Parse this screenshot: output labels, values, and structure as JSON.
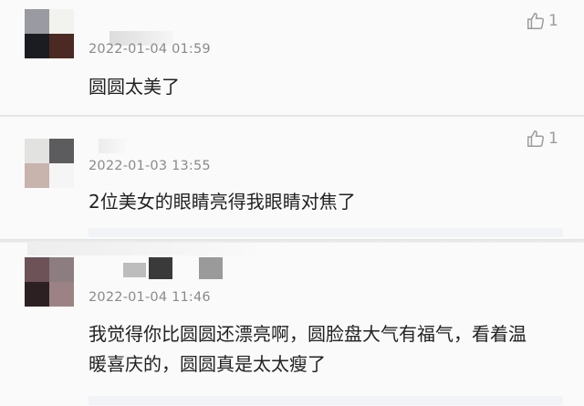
{
  "comments": [
    {
      "timestamp": "2022-01-04 01:59",
      "text": "圆圆太美了",
      "likes": "1"
    },
    {
      "timestamp": "2022-01-03 13:55",
      "text": "2位美女的眼睛亮得我眼睛对焦了",
      "likes": "1"
    },
    {
      "timestamp": "2022-01-04 11:46",
      "text": "我觉得你比圆圆还漂亮啊，圆脸盘大气有福气，看着温暖喜庆的，圆圆真是太太瘦了"
    }
  ],
  "icons": {
    "like": "thumbs-up-icon"
  },
  "colors": {
    "timestamp": "#8a8a8a",
    "text": "#222222",
    "background": "#fafafa"
  }
}
